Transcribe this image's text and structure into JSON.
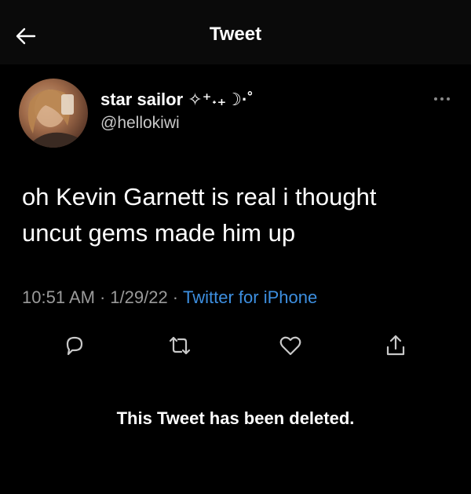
{
  "header": {
    "title": "Tweet",
    "back_icon": "arrow-left-icon"
  },
  "tweet": {
    "author": {
      "display_name": "star sailor ✧⁺˖₊☽·˚",
      "handle": "@hellokiwi"
    },
    "text_line1": "oh Kevin Garnett is real i thought",
    "text_line2": "uncut gems made him up",
    "time": "10:51 AM",
    "date": "1/29/22",
    "separator": "·",
    "source": "Twitter for iPhone"
  },
  "actions": {
    "reply_icon": "reply-icon",
    "retweet_icon": "retweet-icon",
    "like_icon": "heart-icon",
    "share_icon": "share-icon"
  },
  "status": {
    "deleted_message": "This Tweet has been deleted."
  },
  "colors": {
    "background": "#000000",
    "text": "#ffffff",
    "secondary_text": "#9a9a9a",
    "link": "#3d8fe0"
  }
}
